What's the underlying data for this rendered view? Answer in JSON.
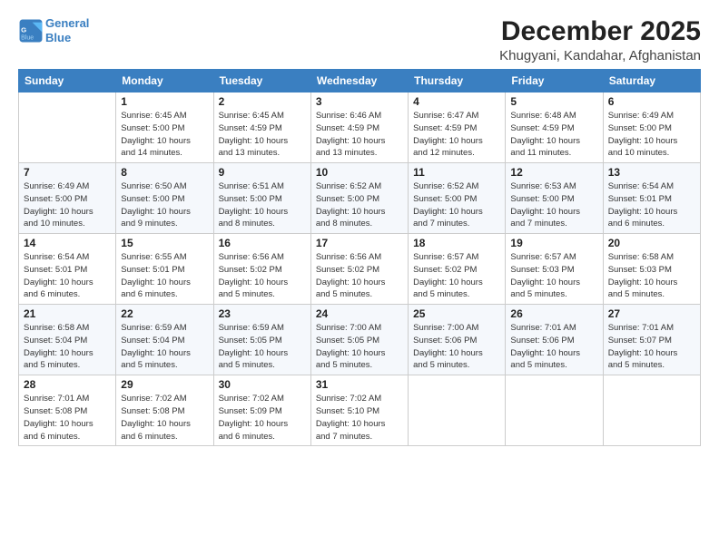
{
  "logo": {
    "line1": "General",
    "line2": "Blue"
  },
  "title": "December 2025",
  "location": "Khugyani, Kandahar, Afghanistan",
  "weekdays": [
    "Sunday",
    "Monday",
    "Tuesday",
    "Wednesday",
    "Thursday",
    "Friday",
    "Saturday"
  ],
  "weeks": [
    [
      {
        "day": "",
        "info": ""
      },
      {
        "day": "1",
        "info": "Sunrise: 6:45 AM\nSunset: 5:00 PM\nDaylight: 10 hours\nand 14 minutes."
      },
      {
        "day": "2",
        "info": "Sunrise: 6:45 AM\nSunset: 4:59 PM\nDaylight: 10 hours\nand 13 minutes."
      },
      {
        "day": "3",
        "info": "Sunrise: 6:46 AM\nSunset: 4:59 PM\nDaylight: 10 hours\nand 13 minutes."
      },
      {
        "day": "4",
        "info": "Sunrise: 6:47 AM\nSunset: 4:59 PM\nDaylight: 10 hours\nand 12 minutes."
      },
      {
        "day": "5",
        "info": "Sunrise: 6:48 AM\nSunset: 4:59 PM\nDaylight: 10 hours\nand 11 minutes."
      },
      {
        "day": "6",
        "info": "Sunrise: 6:49 AM\nSunset: 5:00 PM\nDaylight: 10 hours\nand 10 minutes."
      }
    ],
    [
      {
        "day": "7",
        "info": "Sunrise: 6:49 AM\nSunset: 5:00 PM\nDaylight: 10 hours\nand 10 minutes."
      },
      {
        "day": "8",
        "info": "Sunrise: 6:50 AM\nSunset: 5:00 PM\nDaylight: 10 hours\nand 9 minutes."
      },
      {
        "day": "9",
        "info": "Sunrise: 6:51 AM\nSunset: 5:00 PM\nDaylight: 10 hours\nand 8 minutes."
      },
      {
        "day": "10",
        "info": "Sunrise: 6:52 AM\nSunset: 5:00 PM\nDaylight: 10 hours\nand 8 minutes."
      },
      {
        "day": "11",
        "info": "Sunrise: 6:52 AM\nSunset: 5:00 PM\nDaylight: 10 hours\nand 7 minutes."
      },
      {
        "day": "12",
        "info": "Sunrise: 6:53 AM\nSunset: 5:00 PM\nDaylight: 10 hours\nand 7 minutes."
      },
      {
        "day": "13",
        "info": "Sunrise: 6:54 AM\nSunset: 5:01 PM\nDaylight: 10 hours\nand 6 minutes."
      }
    ],
    [
      {
        "day": "14",
        "info": "Sunrise: 6:54 AM\nSunset: 5:01 PM\nDaylight: 10 hours\nand 6 minutes."
      },
      {
        "day": "15",
        "info": "Sunrise: 6:55 AM\nSunset: 5:01 PM\nDaylight: 10 hours\nand 6 minutes."
      },
      {
        "day": "16",
        "info": "Sunrise: 6:56 AM\nSunset: 5:02 PM\nDaylight: 10 hours\nand 5 minutes."
      },
      {
        "day": "17",
        "info": "Sunrise: 6:56 AM\nSunset: 5:02 PM\nDaylight: 10 hours\nand 5 minutes."
      },
      {
        "day": "18",
        "info": "Sunrise: 6:57 AM\nSunset: 5:02 PM\nDaylight: 10 hours\nand 5 minutes."
      },
      {
        "day": "19",
        "info": "Sunrise: 6:57 AM\nSunset: 5:03 PM\nDaylight: 10 hours\nand 5 minutes."
      },
      {
        "day": "20",
        "info": "Sunrise: 6:58 AM\nSunset: 5:03 PM\nDaylight: 10 hours\nand 5 minutes."
      }
    ],
    [
      {
        "day": "21",
        "info": "Sunrise: 6:58 AM\nSunset: 5:04 PM\nDaylight: 10 hours\nand 5 minutes."
      },
      {
        "day": "22",
        "info": "Sunrise: 6:59 AM\nSunset: 5:04 PM\nDaylight: 10 hours\nand 5 minutes."
      },
      {
        "day": "23",
        "info": "Sunrise: 6:59 AM\nSunset: 5:05 PM\nDaylight: 10 hours\nand 5 minutes."
      },
      {
        "day": "24",
        "info": "Sunrise: 7:00 AM\nSunset: 5:05 PM\nDaylight: 10 hours\nand 5 minutes."
      },
      {
        "day": "25",
        "info": "Sunrise: 7:00 AM\nSunset: 5:06 PM\nDaylight: 10 hours\nand 5 minutes."
      },
      {
        "day": "26",
        "info": "Sunrise: 7:01 AM\nSunset: 5:06 PM\nDaylight: 10 hours\nand 5 minutes."
      },
      {
        "day": "27",
        "info": "Sunrise: 7:01 AM\nSunset: 5:07 PM\nDaylight: 10 hours\nand 5 minutes."
      }
    ],
    [
      {
        "day": "28",
        "info": "Sunrise: 7:01 AM\nSunset: 5:08 PM\nDaylight: 10 hours\nand 6 minutes."
      },
      {
        "day": "29",
        "info": "Sunrise: 7:02 AM\nSunset: 5:08 PM\nDaylight: 10 hours\nand 6 minutes."
      },
      {
        "day": "30",
        "info": "Sunrise: 7:02 AM\nSunset: 5:09 PM\nDaylight: 10 hours\nand 6 minutes."
      },
      {
        "day": "31",
        "info": "Sunrise: 7:02 AM\nSunset: 5:10 PM\nDaylight: 10 hours\nand 7 minutes."
      },
      {
        "day": "",
        "info": ""
      },
      {
        "day": "",
        "info": ""
      },
      {
        "day": "",
        "info": ""
      }
    ]
  ]
}
